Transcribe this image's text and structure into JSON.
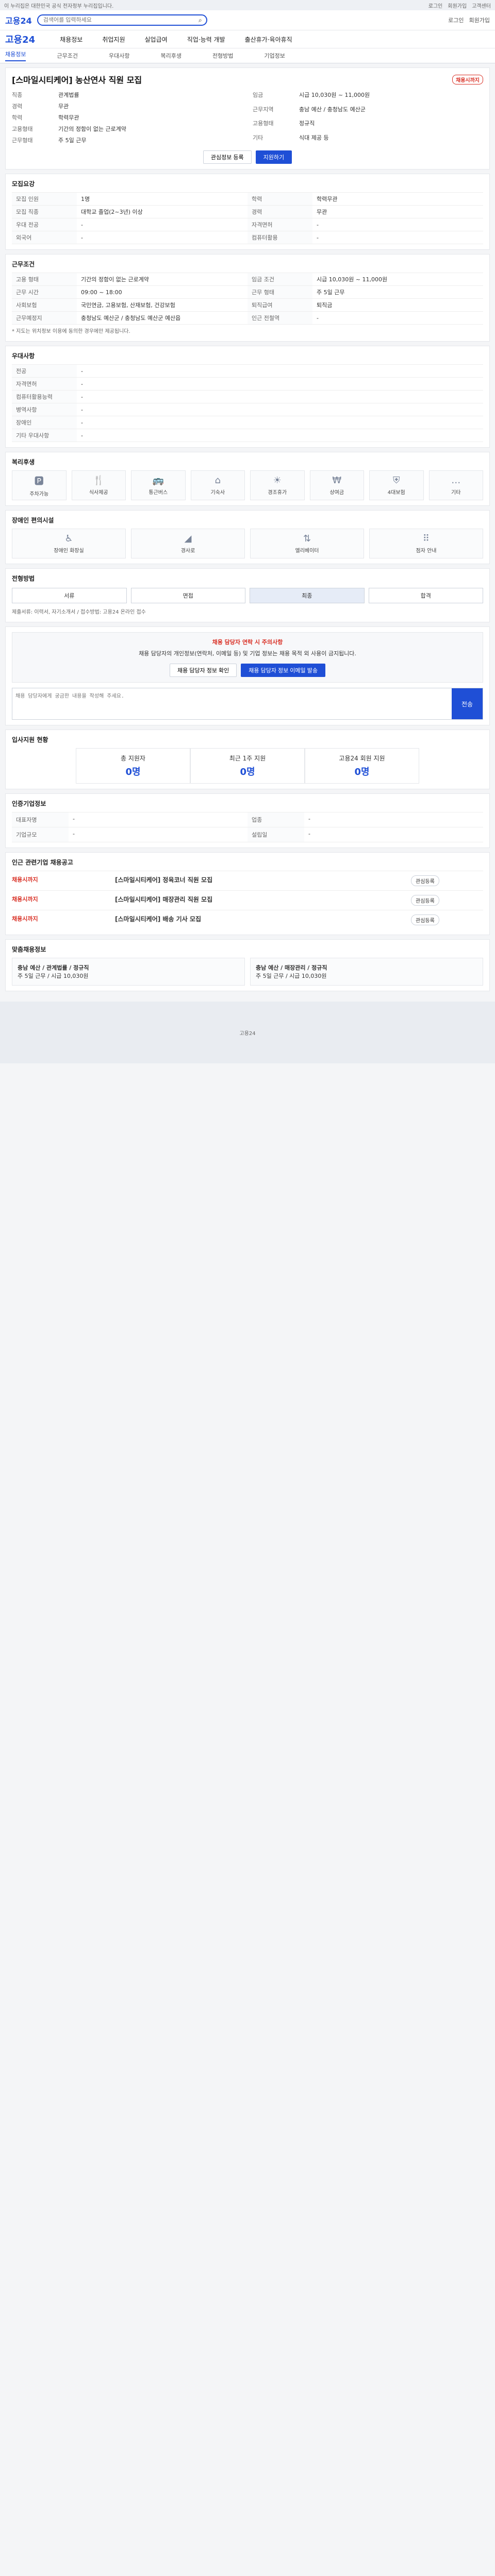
{
  "topbar": {
    "left": "이 누리집은 대한민국 공식 전자정부 누리집입니다.",
    "links": [
      "로그인",
      "회원가입",
      "고객센터"
    ]
  },
  "header": {
    "logo": "고용24",
    "search_placeholder": "검색어를 입력하세요",
    "right": [
      "로그인",
      "회원가입"
    ]
  },
  "gnb": {
    "brand": "고용24",
    "items": [
      "채용정보",
      "취업지원",
      "실업급여",
      "직업·능력 개발",
      "출산휴가·육아휴직"
    ]
  },
  "tabs": {
    "items": [
      "채용정보",
      "근무조건",
      "우대사항",
      "복리후생",
      "전형방법",
      "기업정보"
    ],
    "active_index": 0
  },
  "job": {
    "title": "[스마일시티케어] 농산연사 직원 모집",
    "badge": "채용시까지",
    "left_kv": [
      {
        "k": "직종",
        "v": "관계법률"
      },
      {
        "k": "경력",
        "v": "무관"
      },
      {
        "k": "학력",
        "v": "학력무관"
      },
      {
        "k": "고용형태",
        "v": "기간의 정함이 없는 근로계약"
      },
      {
        "k": "근무형태",
        "v": "주 5일 근무"
      }
    ],
    "right_kv": [
      {
        "k": "임금",
        "v": "시급 10,030원 ~ 11,000원"
      },
      {
        "k": "근무지역",
        "v": "충남 예산 / 충청남도 예산군"
      },
      {
        "k": "고용형태",
        "v": "정규직"
      },
      {
        "k": "기타",
        "v": "식대 제공 등"
      }
    ],
    "buttons": [
      "관심정보 등록",
      "지원하기"
    ]
  },
  "recruit": {
    "title": "모집요강",
    "rows": [
      {
        "k": "모집 인원",
        "v": "1명"
      },
      {
        "k": "학력",
        "v": "학력무관"
      },
      {
        "k": "모집 직종",
        "v": "대학교 졸업(2~3년) 이상"
      },
      {
        "k": "경력",
        "v": "무관"
      },
      {
        "k": "우대 전공",
        "v": "-"
      },
      {
        "k": "자격면허",
        "v": "-"
      },
      {
        "k": "외국어",
        "v": "-"
      },
      {
        "k": "컴퓨터활용",
        "v": "-"
      }
    ]
  },
  "conditions": {
    "title": "근무조건",
    "rows": [
      {
        "k": "고용 형태",
        "v": "기간의 정함이 없는 근로계약"
      },
      {
        "k": "임금 조건",
        "v": "시급 10,030원 ~ 11,000원"
      },
      {
        "k": "근무 시간",
        "v": "09:00 ~ 18:00"
      },
      {
        "k": "근무 형태",
        "v": "주 5일 근무"
      },
      {
        "k": "사회보험",
        "v": "국민연금, 고용보험, 산재보험, 건강보험"
      },
      {
        "k": "퇴직급여",
        "v": "퇴직금"
      },
      {
        "k": "근무예정지",
        "v": "충청남도 예산군 / 충청남도 예산군 예산읍"
      },
      {
        "k": "인근 전철역",
        "v": "-"
      }
    ],
    "note": "* 지도는 위치정보 이용에 동의한 경우에만 제공됩니다."
  },
  "preferences": {
    "title": "우대사항",
    "rows": [
      {
        "k": "전공",
        "v": "-"
      },
      {
        "k": "자격면허",
        "v": "-"
      },
      {
        "k": "컴퓨터활용능력",
        "v": "-"
      },
      {
        "k": "병역사항",
        "v": "-"
      },
      {
        "k": "장애인",
        "v": "-"
      },
      {
        "k": "기타 우대사항",
        "v": "-"
      }
    ]
  },
  "benefits": {
    "title": "복리후생",
    "icons": [
      {
        "name": "parking-icon",
        "label": "주차가능"
      },
      {
        "name": "meal-icon",
        "label": "식사제공"
      },
      {
        "name": "commute-icon",
        "label": "통근버스"
      },
      {
        "name": "dorm-icon",
        "label": "기숙사"
      },
      {
        "name": "vacation-icon",
        "label": "경조휴가"
      },
      {
        "name": "bonus-icon",
        "label": "상여금"
      },
      {
        "name": "insurance-icon",
        "label": "4대보험"
      },
      {
        "name": "more-icon",
        "label": "기타"
      }
    ]
  },
  "disability": {
    "title": "장애인 편의시설",
    "icons": [
      {
        "name": "wheelchair-icon",
        "label": "장애인 화장실"
      },
      {
        "name": "ramp-icon",
        "label": "경사로"
      },
      {
        "name": "elevator-icon",
        "label": "엘리베이터"
      },
      {
        "name": "braille-icon",
        "label": "점자 안내"
      }
    ]
  },
  "process": {
    "title": "전형방법",
    "steps": [
      "서류",
      "면접",
      "최종",
      "합격"
    ],
    "active": 2,
    "note": "제출서류: 이력서, 자기소개서 / 접수방법: 고용24 온라인 접수"
  },
  "contact": {
    "title": "채용 담당자 연락 시 주의사항",
    "text": "채용 담당자의 개인정보(연락처, 이메일 등) 및 기업 정보는 채용 목적 외 사용이 금지됩니다.",
    "buttons": [
      "채용 담당자 정보 확인",
      "채용 담당자 정보 이메일 발송"
    ],
    "message_placeholder": "채용 담당자에게 궁금한 내용을 작성해 주세요.",
    "send_label": "전송"
  },
  "stats": {
    "title": "입사지원 현황",
    "items": [
      {
        "label": "총 지원자",
        "value": "0명"
      },
      {
        "label": "최근 1주 지원",
        "value": "0명"
      },
      {
        "label": "고용24 회원 지원",
        "value": "0명"
      }
    ]
  },
  "info": {
    "title": "인증기업정보",
    "rows": [
      {
        "k": "대표자명",
        "v": "-"
      },
      {
        "k": "업종",
        "v": "-"
      },
      {
        "k": "기업규모",
        "v": "-"
      },
      {
        "k": "설립일",
        "v": "-"
      }
    ]
  },
  "related": {
    "title": "인근 관련기업 채용공고",
    "items": [
      {
        "status": "채용시까지",
        "company": "[스마일시티케어] 정육코너 직원 모집",
        "pill": "관심등록"
      },
      {
        "status": "채용시까지",
        "company": "[스마일시티케어] 매장관리 직원 모집",
        "pill": "관심등록"
      },
      {
        "status": "채용시까지",
        "company": "[스마일시티케어] 배송 기사 모집",
        "pill": "관심등록"
      }
    ]
  },
  "recommend": {
    "title": "맞춤채용정보",
    "cards": [
      {
        "t": "충남 예산 / 관계법률 / 정규직",
        "s": "주 5일 근무 / 시급 10,030원"
      },
      {
        "t": "충남 예산 / 매장관리 / 정규직",
        "s": "주 5일 근무 / 시급 10,030원"
      }
    ]
  }
}
